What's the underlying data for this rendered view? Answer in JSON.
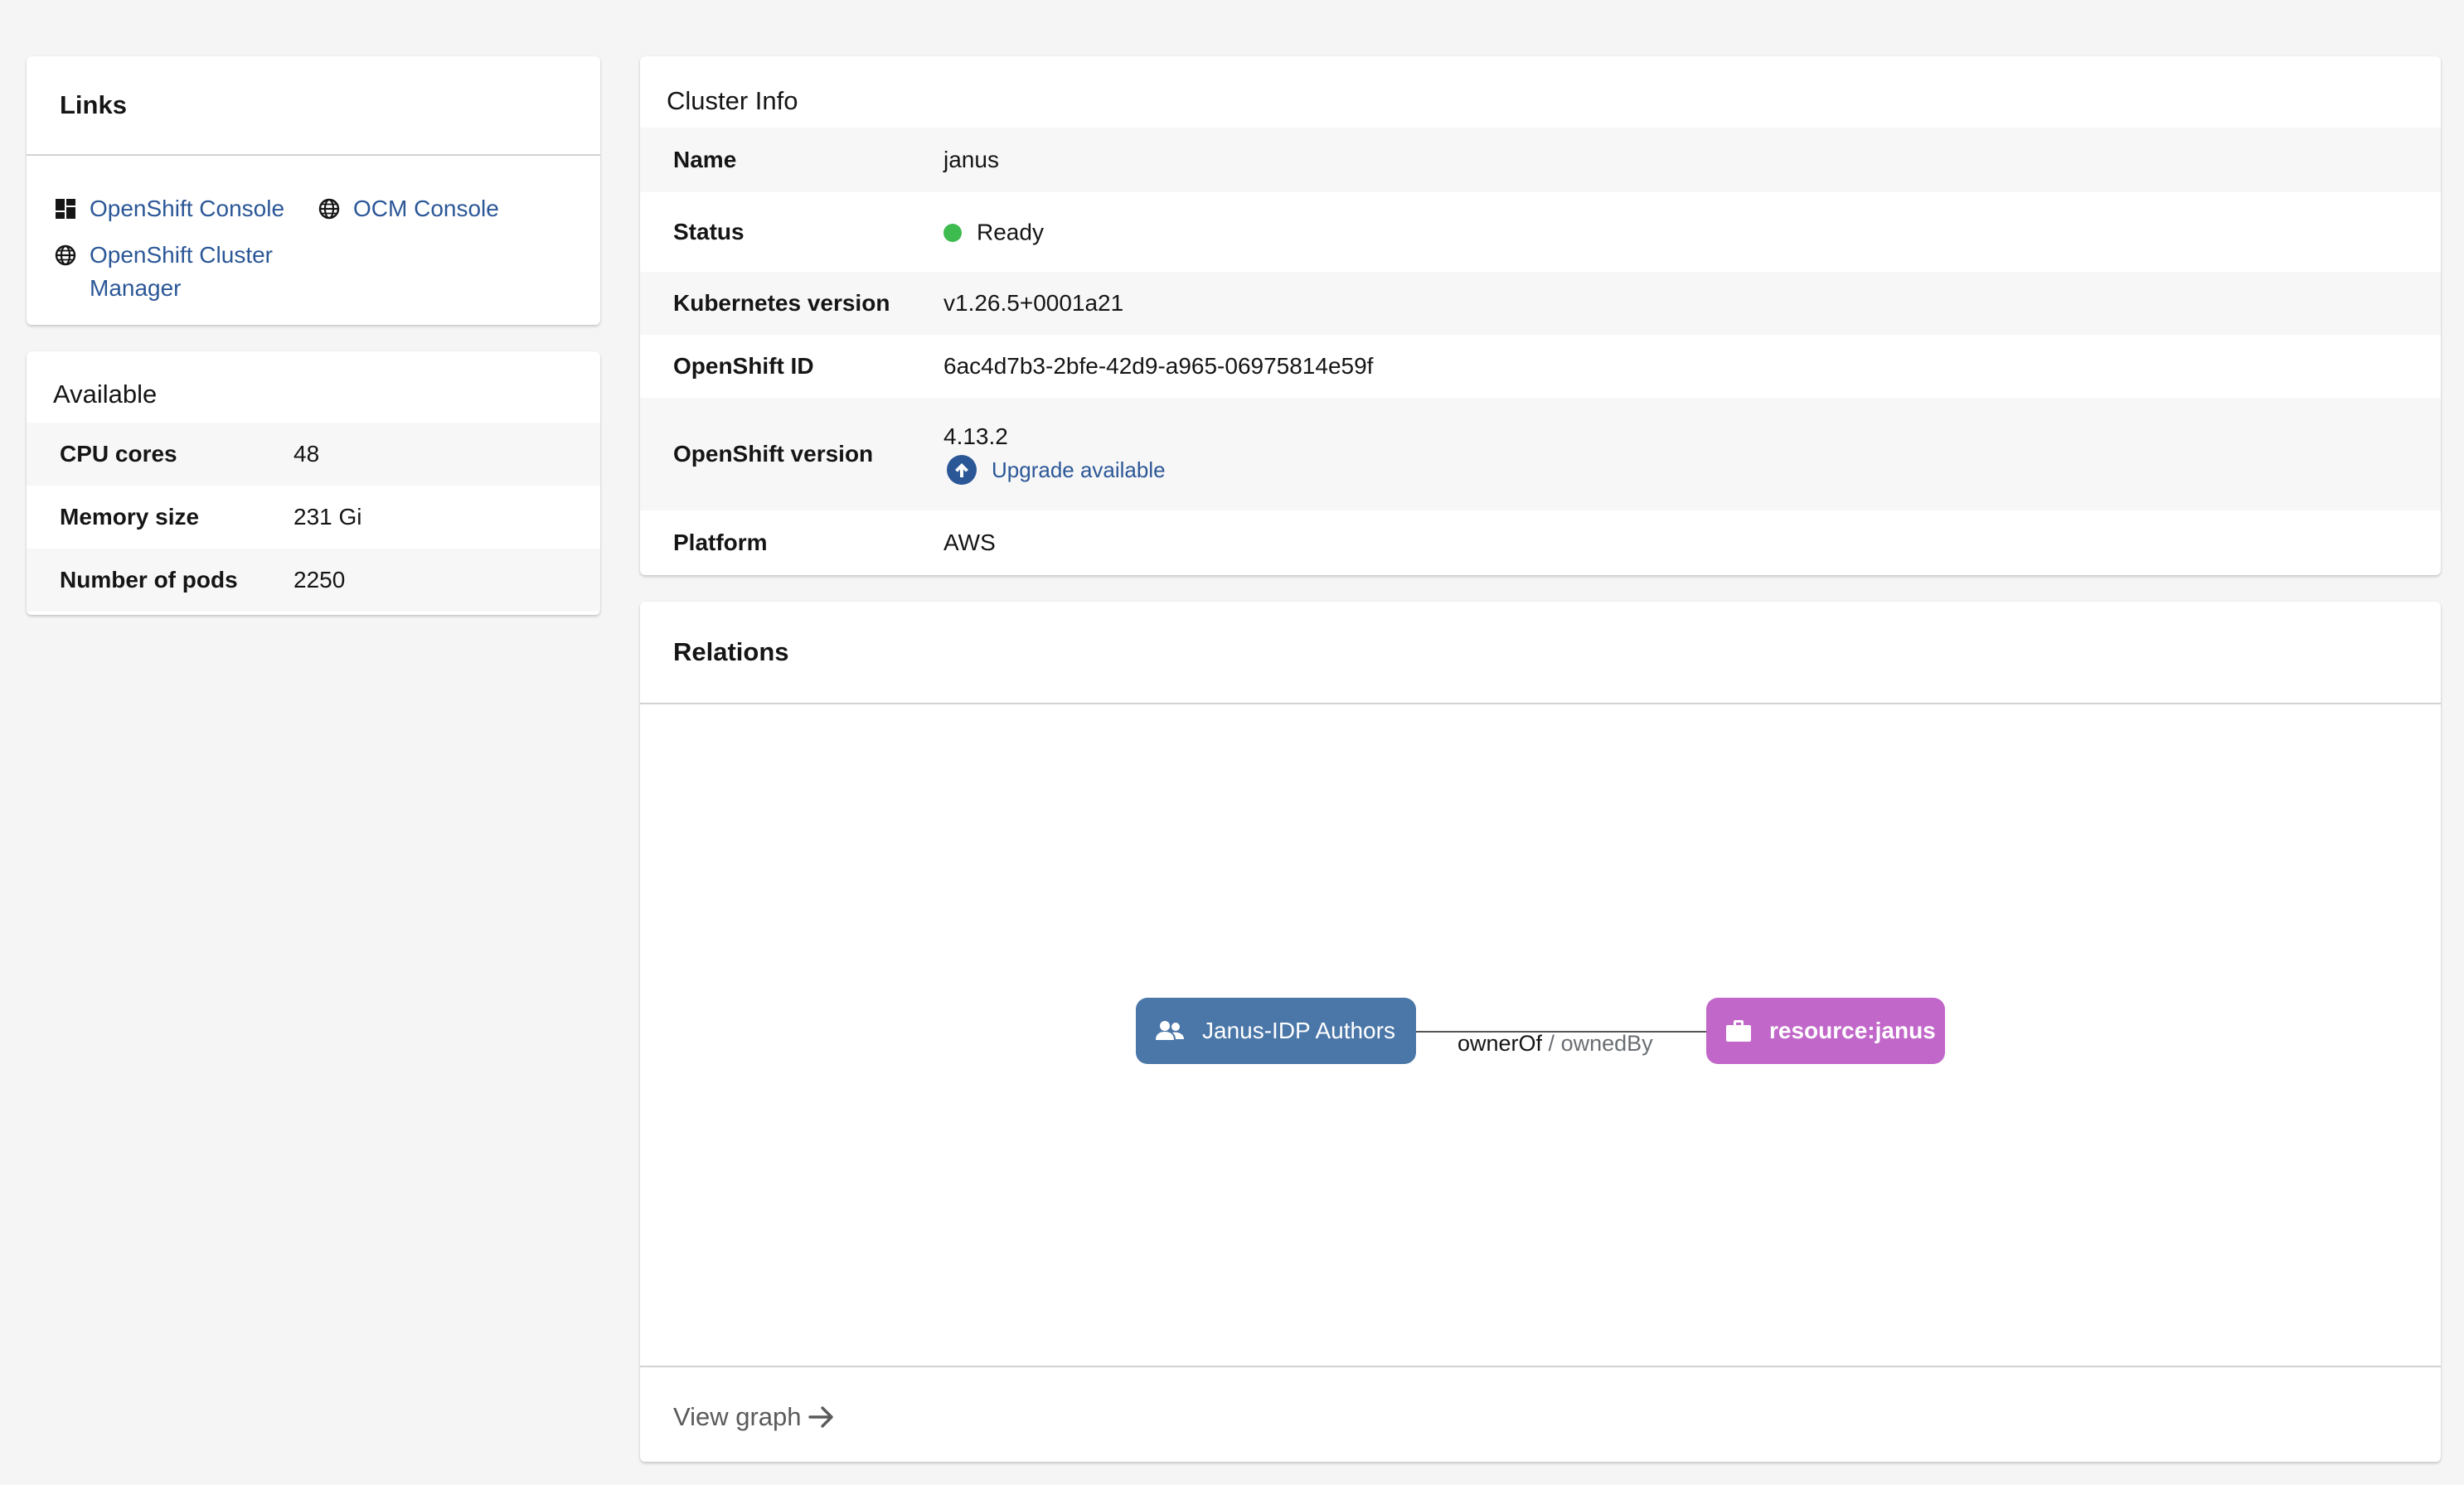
{
  "links": {
    "title": "Links",
    "items": [
      {
        "label": "OpenShift Console",
        "icon": "dashboard-icon"
      },
      {
        "label": "OCM Console",
        "icon": "globe-icon"
      },
      {
        "label_line1": "OpenShift Cluster",
        "label_line2": "Manager",
        "icon": "globe-icon"
      }
    ]
  },
  "available": {
    "title": "Available",
    "rows": [
      {
        "key": "CPU cores",
        "value": "48"
      },
      {
        "key": "Memory size",
        "value": "231 Gi"
      },
      {
        "key": "Number of pods",
        "value": "2250"
      }
    ]
  },
  "cluster_info": {
    "title": "Cluster Info",
    "name_key": "Name",
    "name_value": "janus",
    "status_key": "Status",
    "status_value": "Ready",
    "status_color": "#3dbb4f",
    "k8s_key": "Kubernetes version",
    "k8s_value": "v1.26.5+0001a21",
    "id_key": "OpenShift ID",
    "id_value": "6ac4d7b3-2bfe-42d9-a965-06975814e59f",
    "version_key": "OpenShift version",
    "version_value": "4.13.2",
    "upgrade_label": "Upgrade available",
    "platform_key": "Platform",
    "platform_value": "AWS"
  },
  "relations": {
    "title": "Relations",
    "source_node": {
      "label": "Janus-IDP Authors",
      "icon": "group-icon",
      "color": "#4a76a8"
    },
    "target_node": {
      "label": "resource:janus",
      "icon": "briefcase-icon",
      "color": "#c167c9"
    },
    "edge_primary": "ownerOf",
    "edge_separator": " / ",
    "edge_secondary": "ownedBy",
    "view_graph_label": "View graph"
  },
  "colors": {
    "link": "#2b5797",
    "background": "#f5f5f5"
  }
}
